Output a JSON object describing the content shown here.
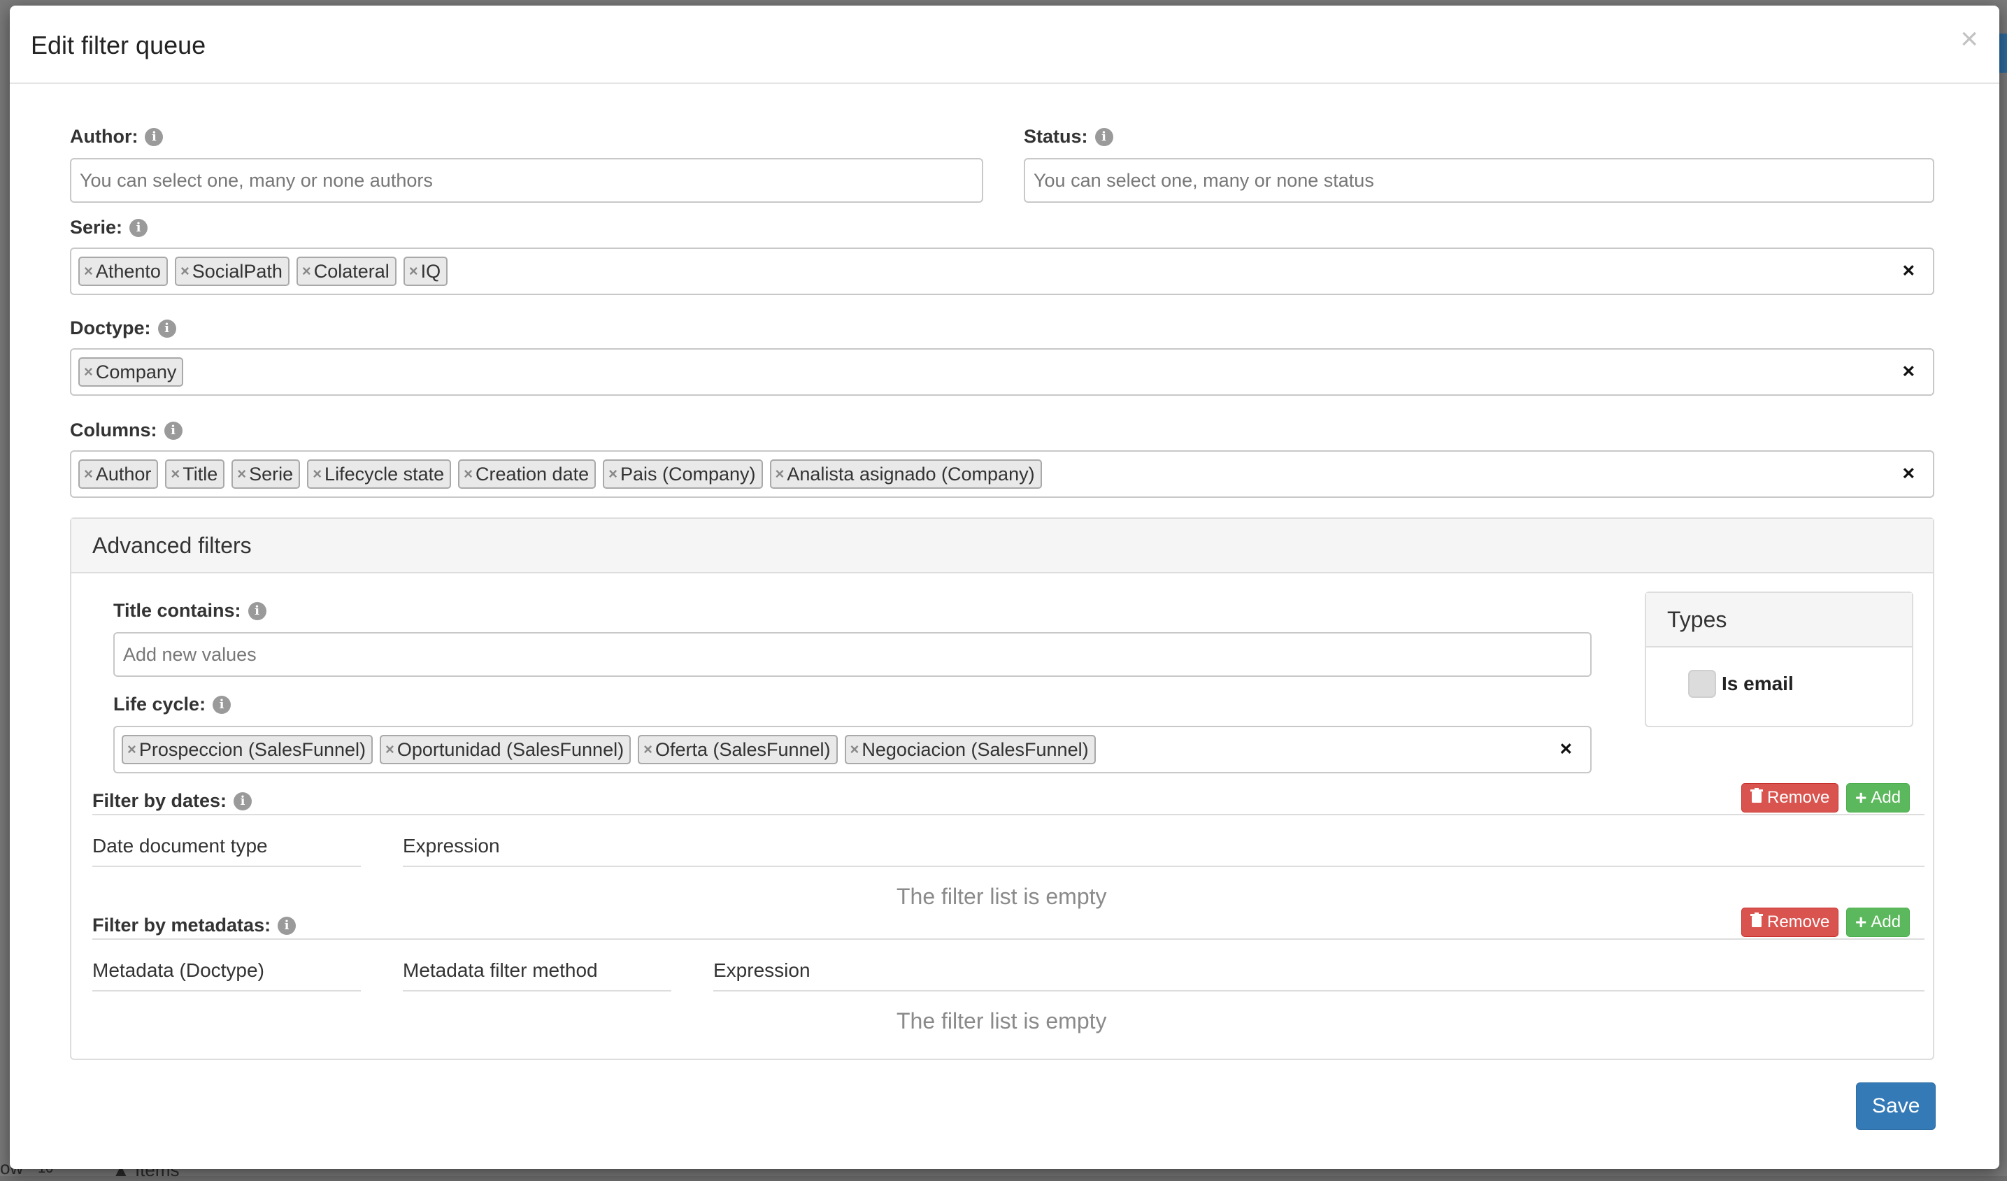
{
  "dialog": {
    "title": "Edit filter queue",
    "close_label": "×"
  },
  "fields": {
    "author": {
      "label": "Author:",
      "placeholder": "You can select one, many or none authors"
    },
    "status": {
      "label": "Status:",
      "placeholder": "You can select one, many or none status"
    },
    "serie": {
      "label": "Serie:",
      "tags": [
        "Athento",
        "SocialPath",
        "Colateral",
        "IQ"
      ]
    },
    "doctype": {
      "label": "Doctype:",
      "tags": [
        "Company"
      ]
    },
    "columns": {
      "label": "Columns:",
      "tags": [
        "Author",
        "Title",
        "Serie",
        "Lifecycle state",
        "Creation date",
        "Pais (Company)",
        "Analista asignado (Company)"
      ]
    }
  },
  "advanced": {
    "title": "Advanced filters",
    "title_contains": {
      "label": "Title contains:",
      "placeholder": "Add new values"
    },
    "life_cycle": {
      "label": "Life cycle:",
      "tags": [
        "Prospeccion (SalesFunnel)",
        "Oportunidad (SalesFunnel)",
        "Oferta (SalesFunnel)",
        "Negociacion (SalesFunnel)"
      ]
    },
    "types": {
      "title": "Types",
      "is_email_label": "Is email",
      "is_email_checked": false
    },
    "filter_by_dates": {
      "label": "Filter by dates:",
      "remove_label": "Remove",
      "add_label": "Add",
      "columns": [
        "Date document type",
        "Expression"
      ],
      "empty_message": "The filter list is empty"
    },
    "filter_by_metadatas": {
      "label": "Filter by metadatas:",
      "remove_label": "Remove",
      "add_label": "Add",
      "columns": [
        "Metadata (Doctype)",
        "Metadata filter method",
        "Expression"
      ],
      "empty_message": "The filter list is empty"
    }
  },
  "save_label": "Save",
  "background": {
    "items_label": "Items",
    "show_label": "ow",
    "page_size": "10"
  },
  "colors": {
    "primary": "#337ab7",
    "danger": "#d9534f",
    "success": "#5cb85c"
  }
}
